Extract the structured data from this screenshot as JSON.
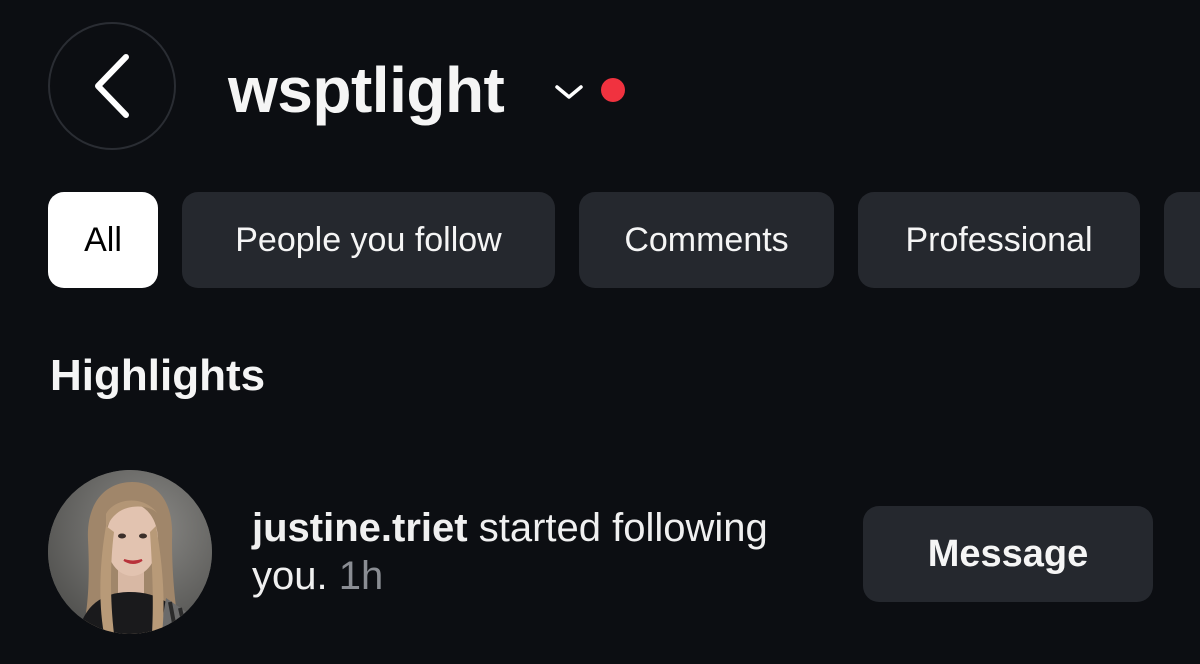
{
  "header": {
    "username": "wsptlight",
    "back_icon": "chevron-left-icon",
    "dropdown_icon": "chevron-down-icon",
    "unread_dot_color": "#f0323f"
  },
  "filters": {
    "selected": "All",
    "chips": [
      {
        "label": "All"
      },
      {
        "label": "People you follow"
      },
      {
        "label": "Comments"
      },
      {
        "label": "Professional"
      },
      {
        "label": ""
      }
    ]
  },
  "highlights": {
    "title": "Highlights",
    "notifications": [
      {
        "actor": "justine.triet",
        "action": "started following you.",
        "time": "1h",
        "button_label": "Message"
      }
    ]
  }
}
